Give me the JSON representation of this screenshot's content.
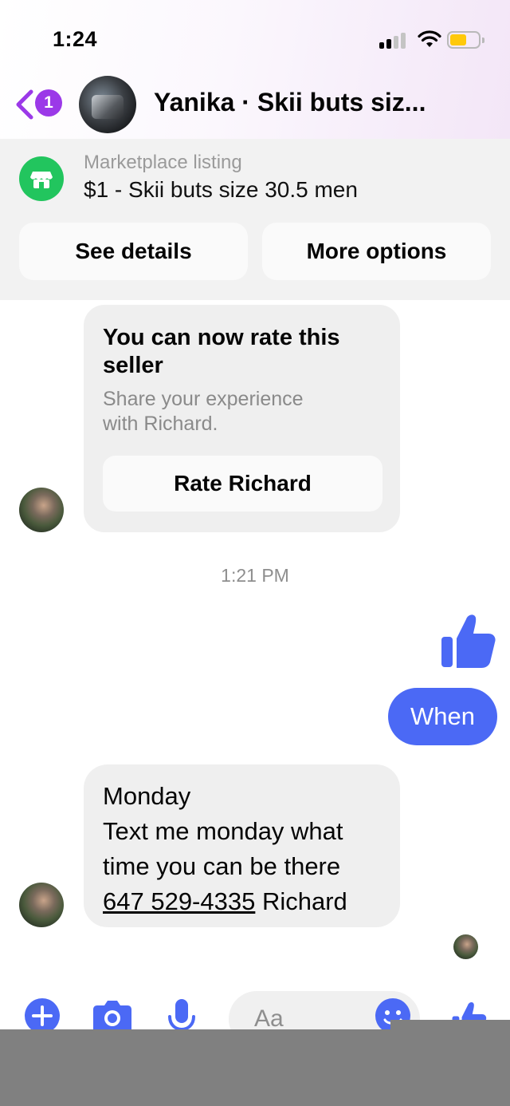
{
  "status_bar": {
    "time": "1:24",
    "battery_color": "#ffc90a"
  },
  "header": {
    "back_icon": "chevron-left-icon",
    "unread_count": "1",
    "title": "Yanika · Skii buts siz..."
  },
  "marketplace": {
    "icon": "storefront-icon",
    "label": "Marketplace listing",
    "listing_title": "$1 - Skii buts size 30.5 men",
    "see_details_label": "See details",
    "more_options_label": "More options"
  },
  "rating_card": {
    "title": "You can now rate this seller",
    "subtitle": "Share your experience with Richard.",
    "button_label": "Rate Richard"
  },
  "messages": {
    "timestamp": "1:21 PM",
    "sent_like_icon": "thumbs-up-icon",
    "sent_text": "When",
    "received_lines": [
      "Monday",
      "Text me monday what",
      "time you can be there"
    ],
    "received_phone": "647 529-4335",
    "received_signature": " Richard"
  },
  "composer": {
    "placeholder": "Aa",
    "icons": [
      "plus-icon",
      "camera-icon",
      "microphone-icon",
      "emoji-icon",
      "thumbs-up-icon"
    ]
  },
  "colors": {
    "accent_blue": "#4b69f5",
    "badge_purple": "#9b39e8",
    "marketplace_green": "#22c55e"
  }
}
